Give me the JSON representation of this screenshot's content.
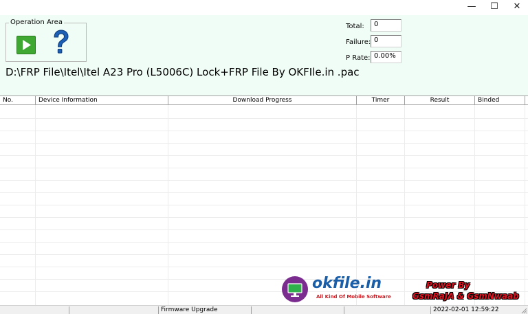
{
  "window": {
    "minimize_glyph": "—",
    "maximize_glyph": "☐",
    "close_glyph": "✕"
  },
  "operation_area": {
    "legend": "Operation Area",
    "start_icon": "play-icon",
    "help_icon": "help-icon"
  },
  "stats": {
    "total_label": "Total:",
    "total_value": "0",
    "failure_label": "Failure:",
    "failure_value": "0",
    "rate_label": "P Rate:",
    "rate_value": "0.00%"
  },
  "file_path": "D:\\FRP File\\Itel\\Itel A23 Pro (L5006C) Lock+FRP File By OKFIle.in .pac",
  "table": {
    "columns": [
      "No.",
      "Device Information",
      "Download Progress",
      "Timer",
      "Result",
      "Binded"
    ],
    "rows": []
  },
  "statusbar": {
    "mode": "Firmware Upgrade",
    "datetime": "2022-02-01 12:59:22"
  },
  "watermark": {
    "title": "okfile.in",
    "subtitle": "All Kind Of Mobile Software",
    "power_line1": "Power By",
    "power_line2": "GsmRaJA  &  GsmNwaab"
  },
  "colors": {
    "top_background": "#f0fdf6",
    "play_green": "#3fa832",
    "help_blue": "#1d5fb4",
    "watermark_blue": "#1a5ea8",
    "power_red": "#e1101f"
  }
}
